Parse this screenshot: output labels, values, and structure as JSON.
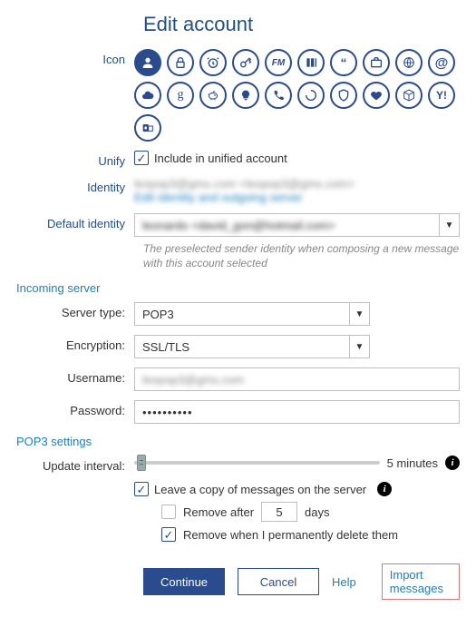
{
  "title": "Edit account",
  "labels": {
    "icon": "Icon",
    "unify": "Unify",
    "identity": "Identity",
    "default_identity": "Default identity",
    "server_type": "Server type:",
    "encryption": "Encryption:",
    "username": "Username:",
    "password": "Password:",
    "update_interval": "Update interval:"
  },
  "unify": {
    "checked": true,
    "label": "Include in unified account"
  },
  "identity": {
    "value_blurred": "leopop3@gmx.com <leopop3@gmx.com>",
    "edit_link": "Edit identity and outgoing server"
  },
  "default_identity": {
    "value_blurred": "leonardo <david_gon@hotmail.com>",
    "helper": "The preselected sender identity when composing a new message with this account selected"
  },
  "sections": {
    "incoming": "Incoming server",
    "pop3": "POP3 settings"
  },
  "server": {
    "type": "POP3",
    "encryption": "SSL/TLS",
    "username_blurred": "leopop3@gmx.com",
    "password_mask": "••••••••••"
  },
  "update": {
    "value_label": "5 minutes",
    "leave_copy": {
      "checked": true,
      "label": "Leave a copy of messages on the server"
    },
    "remove_after": {
      "checked": false,
      "label_before": "Remove after",
      "days": "5",
      "label_after": "days"
    },
    "remove_delete": {
      "checked": true,
      "label": "Remove when I permanently delete them"
    }
  },
  "buttons": {
    "continue": "Continue",
    "cancel": "Cancel",
    "help": "Help",
    "import": "Import messages"
  },
  "icons": [
    "person",
    "lock",
    "alarm",
    "key",
    "fm",
    "logo",
    "quote",
    "briefcase",
    "globe",
    "at",
    "cloud",
    "g",
    "piggy",
    "bulb",
    "phone",
    "circle",
    "shield",
    "heart",
    "cube",
    "yahoo",
    "outlook"
  ]
}
